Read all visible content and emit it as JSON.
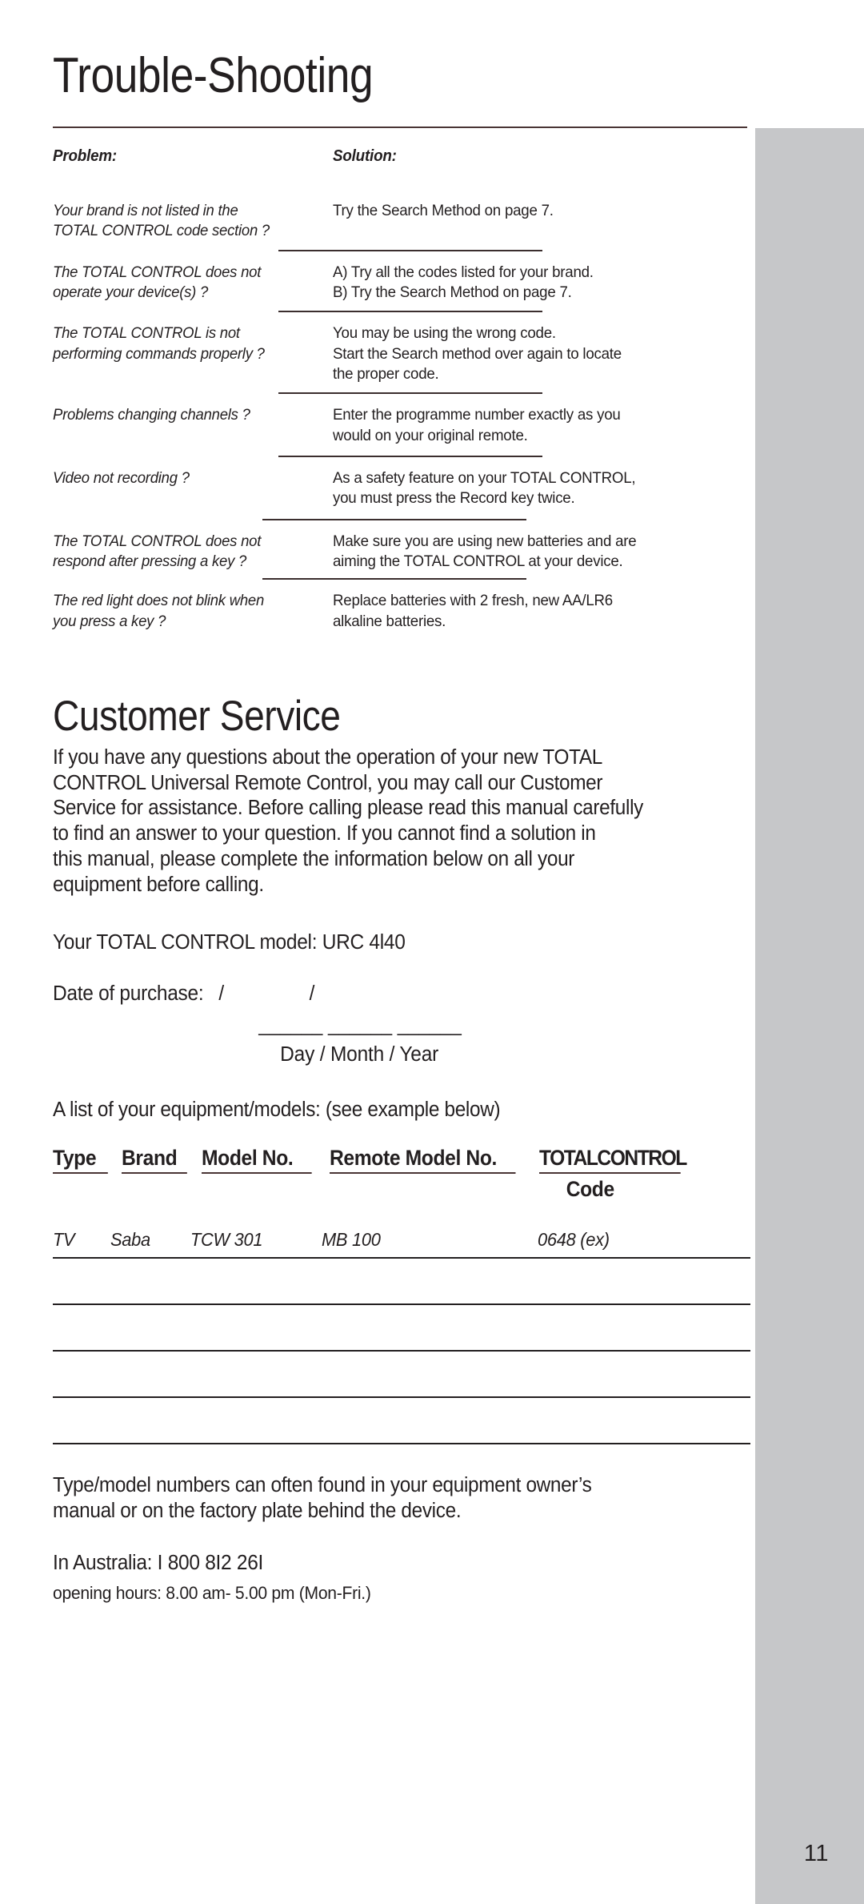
{
  "page": {
    "number": "11",
    "chapter_title": "Trouble-Shooting"
  },
  "troubleshooting": {
    "header": {
      "problem": "Problem:",
      "solution": "Solution:"
    },
    "rows": [
      {
        "problem_line1": "Your brand is not listed in the",
        "problem_line2": "TOTAL CONTROL code section ?",
        "solution_line1": "Try the Search Method on page 7.",
        "solution_line2": "",
        "solution_line3": ""
      },
      {
        "problem_line1": "The TOTAL CONTROL does not",
        "problem_line2": "operate your device(s) ?",
        "solution_line1": "A) Try all the codes listed for your brand.",
        "solution_line2": "B) Try the Search Method on page 7.",
        "solution_line3": ""
      },
      {
        "problem_line1": "The TOTAL CONTROL is not",
        "problem_line2": "performing commands properly ?",
        "solution_line1": "You may be using the wrong code.",
        "solution_line2": "Start the Search method over again to locate",
        "solution_line3": "the proper code."
      },
      {
        "problem_line1": "Problems changing channels ?",
        "problem_line2": "",
        "solution_line1": "Enter the programme number exactly as you",
        "solution_line2": "would on your original remote.",
        "solution_line3": ""
      },
      {
        "problem_line1": "Video not recording ?",
        "problem_line2": "",
        "solution_line1": "As  a safety feature on your TOTAL CONTROL,",
        "solution_line2": "you must press the Record key twice.",
        "solution_line3": ""
      },
      {
        "problem_line1": "The TOTAL CONTROL does not",
        "problem_line2": "respond after pressing a key ?",
        "solution_line1": "Make sure you are using new batteries  and are",
        "solution_line2": "aiming the TOTAL CONTROL at your device.",
        "solution_line3": ""
      },
      {
        "problem_line1": "The red light does not blink when",
        "problem_line2": "you press a key ?",
        "solution_line1": "Replace batteries with 2 fresh, new AA/LR6",
        "solution_line2": "alkaline batteries.",
        "solution_line3": ""
      }
    ]
  },
  "customer_service": {
    "title": "Customer Service",
    "paragraph_lines": [
      "If you have any questions about the operation of your new TOTAL",
      "CONTROL Universal Remote Control, you may call our Customer",
      "Service for assistance. Before calling please read this manual carefully",
      "to find an answer to your question. If you cannot find a solution in",
      "this manual, please complete the information below on all your",
      "equipment before calling."
    ],
    "model_line": "Your TOTAL CONTROL model: URC 4l40",
    "date_label": "Date of purchase:",
    "date_slash_1": "/",
    "date_slash_2": "/",
    "date_blanks": "______ ______ ______",
    "date_legend": "Day   / Month /  Year"
  },
  "equipment_table": {
    "intro": "A list of your equipment/models: (see example below)",
    "headers": {
      "type": "Type",
      "brand": "Brand",
      "model_no": "Model No.",
      "remote_model_no": "Remote Model No.",
      "total_control_code_line1": "TOTALCONTROL",
      "total_control_code_line2": "Code"
    },
    "example_row": {
      "type": "TV",
      "brand": "Saba",
      "model_no": "TCW 301",
      "remote_model_no": "MB 100",
      "code": "0648 (ex)"
    },
    "blank_row_count": 4
  },
  "footer": {
    "note_line1": "Type/model numbers can often found in your equipment owner’s",
    "note_line2": "manual or on the factory plate behind the device.",
    "phone_line": "In Australia: I 800 8I2 26I",
    "hours_line": "opening hours: 8.00 am- 5.00 pm (Mon-Fri.)"
  }
}
